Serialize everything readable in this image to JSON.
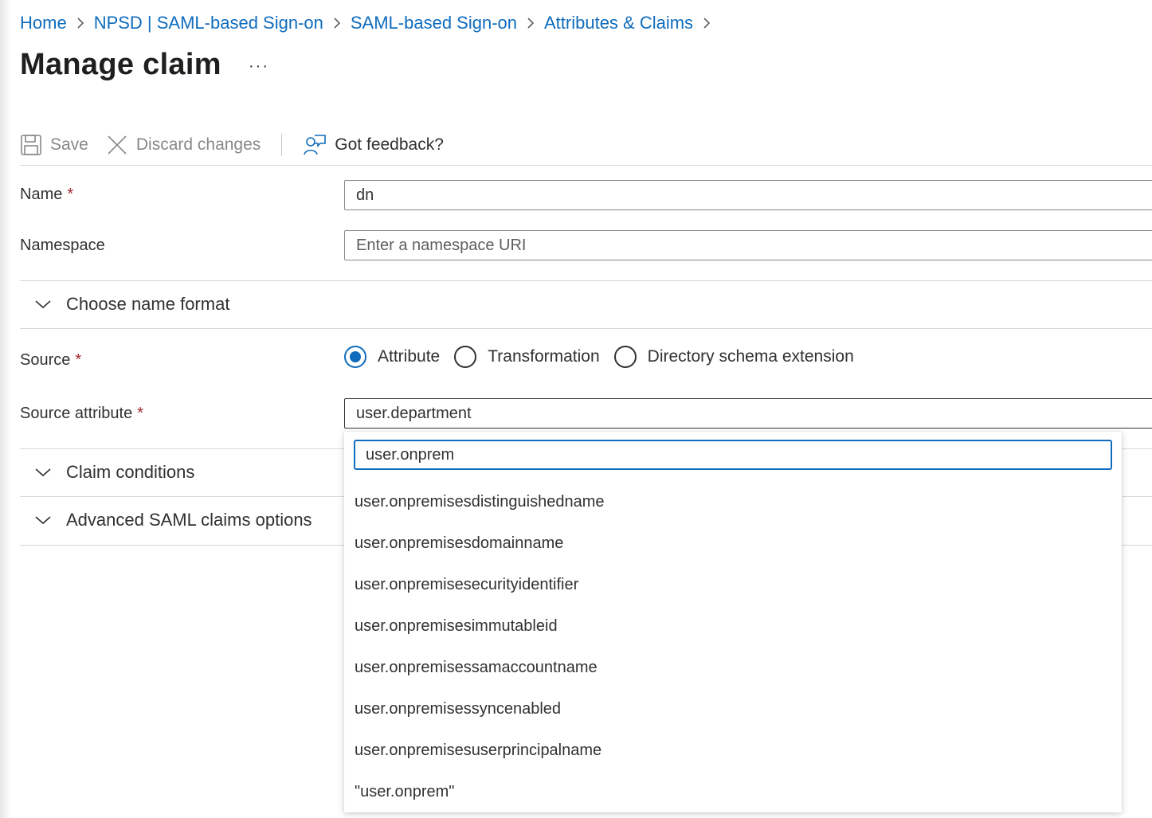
{
  "breadcrumb": {
    "items": [
      "Home",
      "NPSD | SAML-based Sign-on",
      "SAML-based Sign-on",
      "Attributes & Claims"
    ]
  },
  "page": {
    "title": "Manage claim",
    "more_label": "···"
  },
  "toolbar": {
    "save_label": "Save",
    "discard_label": "Discard changes",
    "feedback_label": "Got feedback?"
  },
  "form": {
    "name": {
      "label": "Name",
      "required_mark": "*",
      "value": "dn"
    },
    "namespace": {
      "label": "Namespace",
      "placeholder": "Enter a namespace URI"
    },
    "name_format_section": "Choose name format",
    "source": {
      "label": "Source",
      "required_mark": "*",
      "options": [
        "Attribute",
        "Transformation",
        "Directory schema extension"
      ],
      "selected": "Attribute"
    },
    "source_attribute": {
      "label": "Source attribute",
      "required_mark": "*",
      "value": "user.department"
    },
    "claim_conditions_section": "Claim conditions",
    "advanced_section": "Advanced SAML claims options"
  },
  "dropdown": {
    "filter_value": "user.onprem",
    "options": [
      "user.onpremisesdistinguishedname",
      "user.onpremisesdomainname",
      "user.onpremisesecurityidentifier",
      "user.onpremisesimmutableid",
      "user.onpremisessamaccountname",
      "user.onpremisessyncenabled",
      "user.onpremisesuserprincipalname",
      "\"user.onprem\""
    ]
  },
  "colors": {
    "accent": "#0f6cbd",
    "required": "#a4262c",
    "disabled_text": "#8a8886"
  }
}
